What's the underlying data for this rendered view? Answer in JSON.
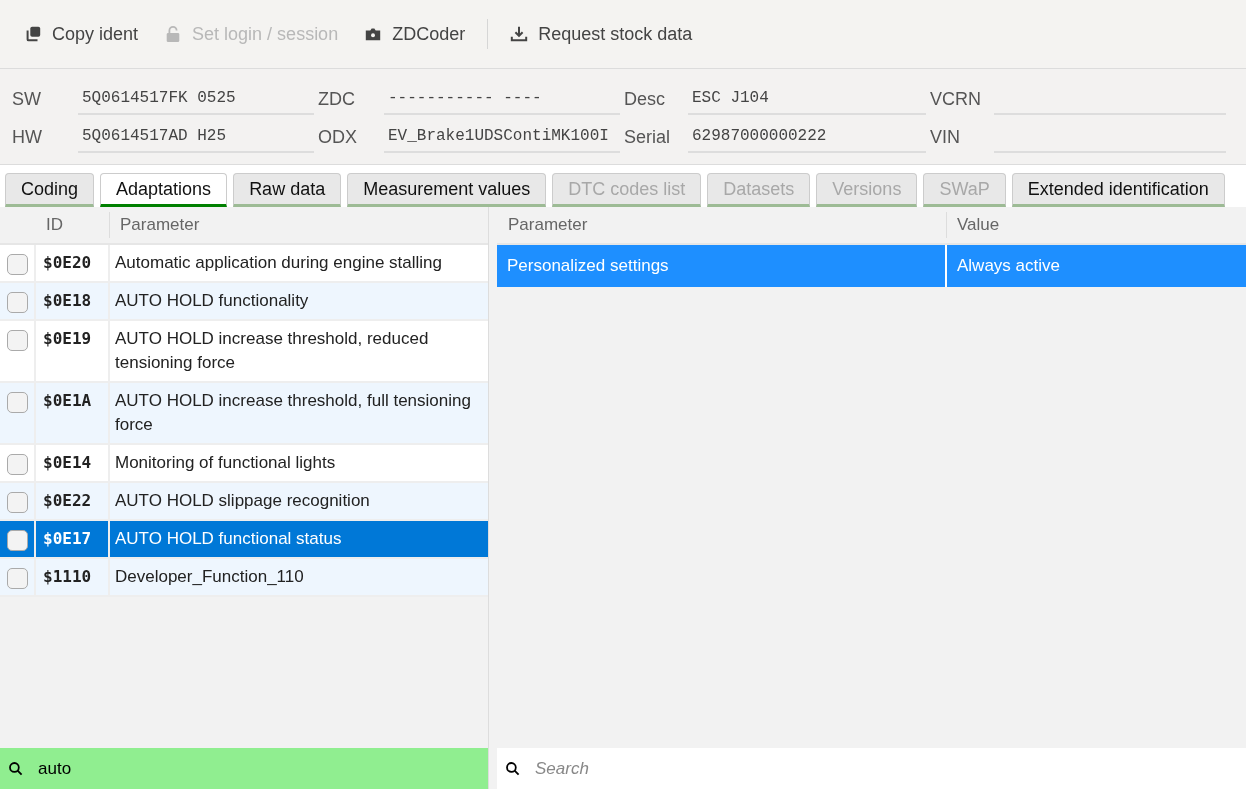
{
  "toolbar": [
    {
      "label": "Copy ident",
      "disabled": false
    },
    {
      "label": "Set login / session",
      "disabled": true
    },
    {
      "label": "ZDCoder",
      "disabled": false
    },
    {
      "label": "Request stock data",
      "disabled": false
    }
  ],
  "ident": [
    {
      "label": "SW",
      "value": "5Q0614517FK 0525"
    },
    {
      "label": "ZDC",
      "value": "----------- ----"
    },
    {
      "label": "Desc",
      "value": "ESC J104"
    },
    {
      "label": "VCRN"
    },
    {
      "label": "HW",
      "value": "5Q0614517AD H25"
    },
    {
      "label": "ODX",
      "value": "EV_Brake1UDSContiMK100I"
    },
    {
      "label": "Serial",
      "value": "62987000000222"
    },
    {
      "label": "VIN"
    }
  ],
  "tabs": [
    {
      "label": "Coding",
      "selected": false,
      "disabled": false
    },
    {
      "label": "Adaptations",
      "selected": true,
      "disabled": false
    },
    {
      "label": "Raw data",
      "selected": false,
      "disabled": false
    },
    {
      "label": "Measurement values",
      "selected": false,
      "disabled": false
    },
    {
      "label": "DTC codes list",
      "selected": false,
      "disabled": true
    },
    {
      "label": "Datasets",
      "selected": false,
      "disabled": true
    },
    {
      "label": "Versions",
      "selected": false,
      "disabled": true
    },
    {
      "label": "SWaP",
      "selected": false,
      "disabled": true
    },
    {
      "label": "Extended identification",
      "selected": false,
      "disabled": false
    }
  ],
  "adaptations": {
    "columns": [
      "ID",
      "Parameter"
    ],
    "rows": [
      {
        "id": "$0E20",
        "parameter": "Automatic application during engine stalling",
        "checked": false,
        "selected": false
      },
      {
        "id": "$0E18",
        "parameter": "AUTO HOLD functionality",
        "checked": false,
        "selected": false
      },
      {
        "id": "$0E19",
        "parameter": "AUTO HOLD increase threshold, reduced tensioning force",
        "checked": false,
        "selected": false
      },
      {
        "id": "$0E1A",
        "parameter": "AUTO HOLD increase threshold, full tensioning force",
        "checked": false,
        "selected": false
      },
      {
        "id": "$0E14",
        "parameter": "Monitoring of functional lights",
        "checked": false,
        "selected": false
      },
      {
        "id": "$0E22",
        "parameter": "AUTO HOLD slippage recognition",
        "checked": false,
        "selected": false
      },
      {
        "id": "$0E17",
        "parameter": "AUTO HOLD functional status",
        "checked": false,
        "selected": true
      },
      {
        "id": "$1110",
        "parameter": "Developer_Function_110",
        "checked": false,
        "selected": false
      }
    ],
    "search": {
      "value": "auto",
      "active": true
    }
  },
  "values": {
    "columns": [
      "Parameter",
      "Value"
    ],
    "rows": [
      {
        "parameter": "Personalized settings",
        "value": "Always active",
        "selected": true
      }
    ],
    "search": {
      "placeholder": "Search",
      "active": false
    }
  }
}
